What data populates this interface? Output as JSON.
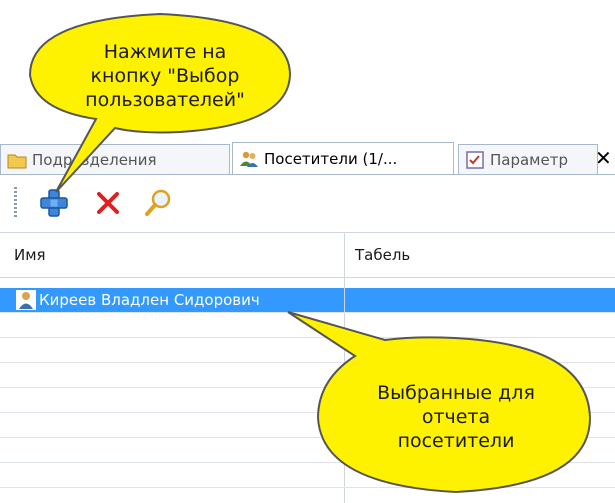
{
  "tabs": [
    {
      "label": "Подразделения",
      "icon": "folder-icon"
    },
    {
      "label": "Посетители (1/...",
      "icon": "users-icon"
    },
    {
      "label": "Параметр",
      "icon": "checklist-icon"
    }
  ],
  "toolbar": {
    "add_icon": "add-users-icon",
    "delete_icon": "delete-icon",
    "search_icon": "search-icon"
  },
  "grid": {
    "columns": [
      "Имя",
      "Табель"
    ],
    "rows": [
      {
        "name": "Киреев Владлен Сидорович",
        "tabel": "",
        "selected": true
      }
    ]
  },
  "callouts": {
    "top": [
      "Нажмите на",
      "кнопку \"Выбор",
      "пользователей\""
    ],
    "bottom": [
      "Выбранные для",
      "отчета",
      "посетители"
    ]
  },
  "colors": {
    "callout_fill": "#fff200",
    "callout_border": "#555555",
    "selection": "#3399ff",
    "accent_blue": "#1f6fd1",
    "delete_red": "#e02020"
  }
}
